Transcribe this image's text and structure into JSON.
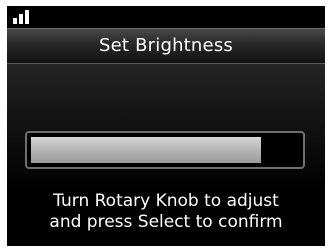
{
  "status_bar": {
    "signal_icon": "signal-strength-icon",
    "signal_level": 3,
    "signal_max": 3
  },
  "title": "Set Brightness",
  "brightness": {
    "level_fraction": 0.86
  },
  "instructions": {
    "line1": "Turn Rotary Knob to adjust",
    "line2": "and press Select to confirm"
  },
  "colors": {
    "screen_background": "#000000",
    "text": "#ffffff",
    "slider_border": "#6f6f6f",
    "slider_fill": "#b4b4b4"
  }
}
